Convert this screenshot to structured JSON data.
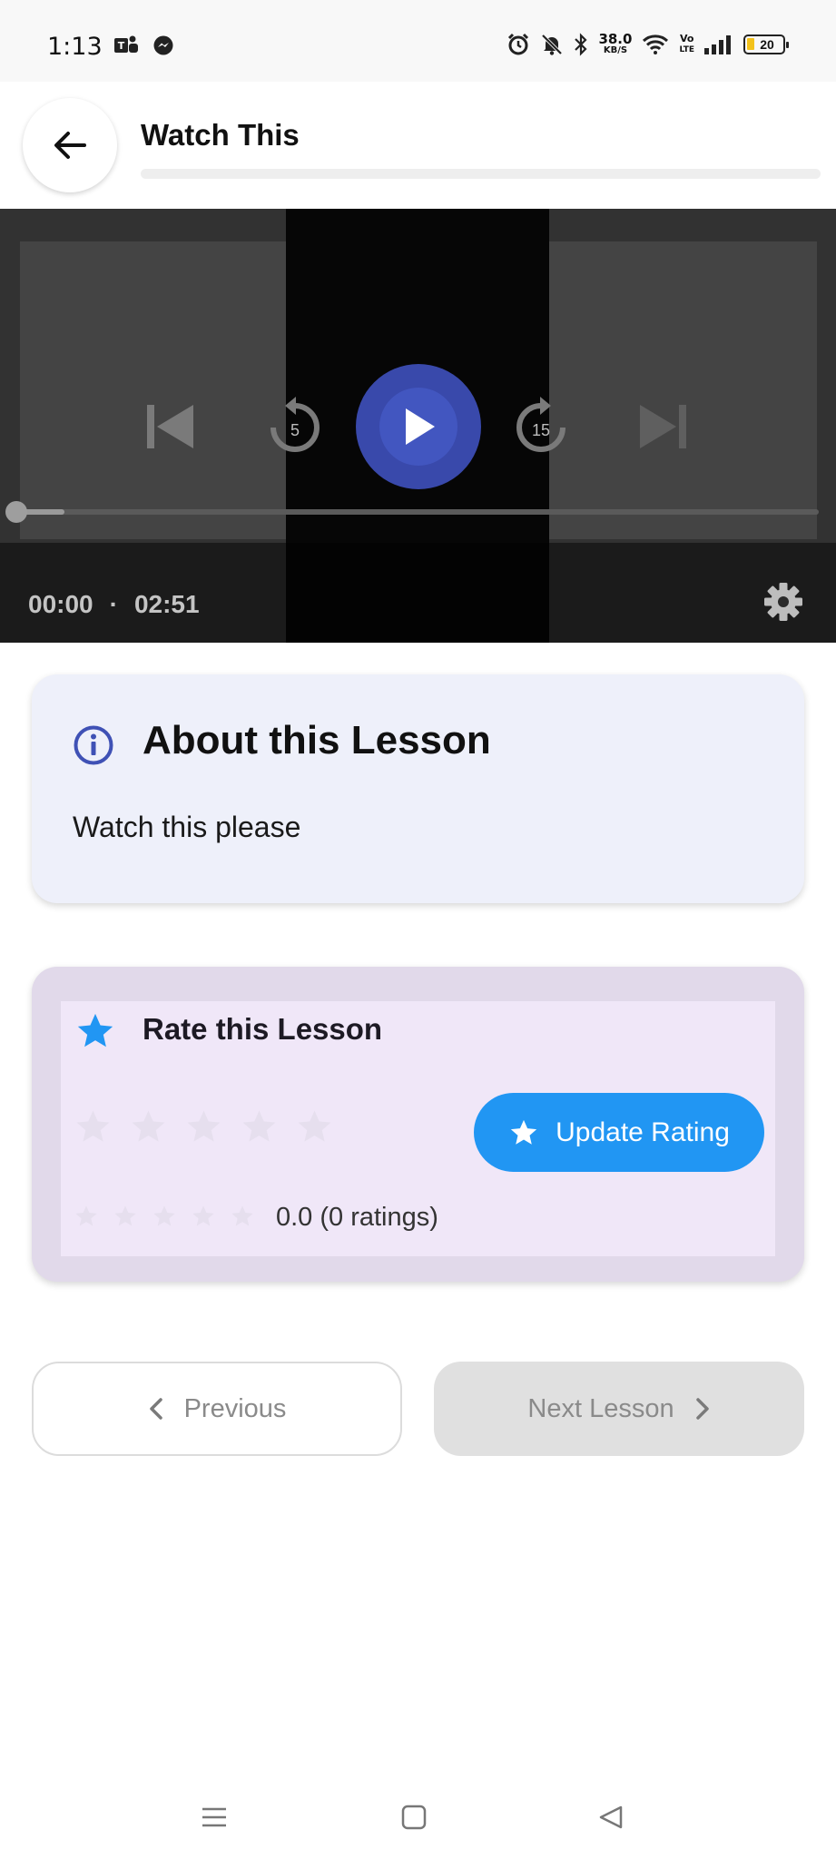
{
  "status_bar": {
    "time": "1:13",
    "net_speed_value": "38.0",
    "net_speed_unit": "KB/S",
    "volte_top": "Vo",
    "volte_bottom": "LTE",
    "battery": "20"
  },
  "header": {
    "title": "Watch This",
    "progress": 0
  },
  "player": {
    "current_time": "00:00",
    "separator": "·",
    "duration": "02:51",
    "rewind_seconds": "5",
    "forward_seconds": "15",
    "buffered_fraction": 0.06
  },
  "about": {
    "title": "About this Lesson",
    "description": "Watch this please"
  },
  "rating": {
    "title": "Rate this Lesson",
    "user_rating": 0,
    "update_label": "Update Rating",
    "summary": "0.0 (0 ratings)"
  },
  "nav": {
    "previous_label": "Previous",
    "next_label": "Next Lesson"
  },
  "colors": {
    "accent": "#3949ab",
    "rating_blue": "#2196f3",
    "about_bg": "#eef0fa",
    "rating_bg": "#f0e7f8"
  },
  "icons": {
    "back": "arrow-left-icon",
    "skip_previous": "skip-previous-icon",
    "rewind": "replay-5-icon",
    "play": "play-icon",
    "forward": "forward-15-icon",
    "skip_next": "skip-next-icon",
    "settings": "gear-icon",
    "info": "info-icon",
    "star": "star-icon"
  }
}
